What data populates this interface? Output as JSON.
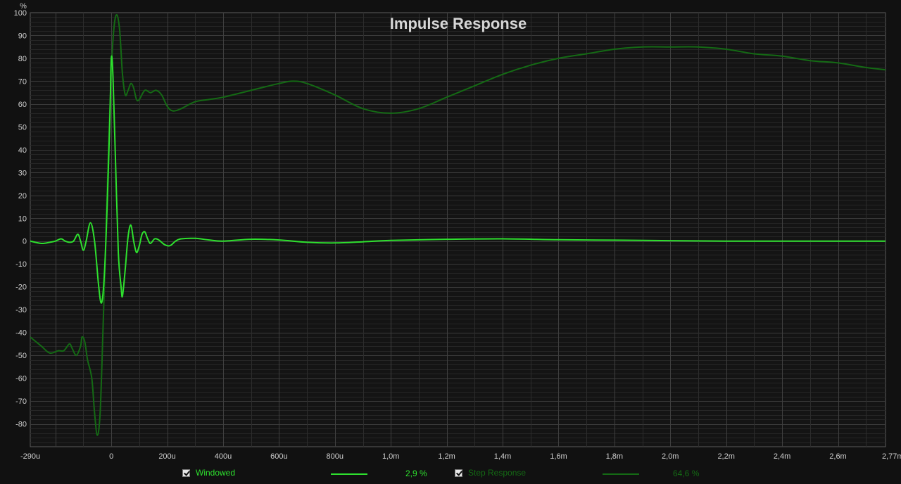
{
  "chart_data": {
    "type": "line",
    "title": "Impulse Response",
    "y_unit": "%",
    "x_unit": "ms",
    "xlim": [
      -0.29,
      2.77
    ],
    "ylim": [
      -90,
      100
    ],
    "x_ticks": [
      {
        "v": -0.29,
        "label": "-290u"
      },
      {
        "v": 0,
        "label": "0"
      },
      {
        "v": 0.2,
        "label": "200u"
      },
      {
        "v": 0.4,
        "label": "400u"
      },
      {
        "v": 0.6,
        "label": "600u"
      },
      {
        "v": 0.8,
        "label": "800u"
      },
      {
        "v": 1.0,
        "label": "1,0m"
      },
      {
        "v": 1.2,
        "label": "1,2m"
      },
      {
        "v": 1.4,
        "label": "1,4m"
      },
      {
        "v": 1.6,
        "label": "1,6m"
      },
      {
        "v": 1.8,
        "label": "1,8m"
      },
      {
        "v": 2.0,
        "label": "2,0m"
      },
      {
        "v": 2.2,
        "label": "2,2m"
      },
      {
        "v": 2.4,
        "label": "2,4m"
      },
      {
        "v": 2.6,
        "label": "2,6m"
      },
      {
        "v": 2.77,
        "label": "2,77ms"
      }
    ],
    "y_ticks": [
      {
        "v": 100,
        "label": "100"
      },
      {
        "v": 90,
        "label": "90"
      },
      {
        "v": 80,
        "label": "80"
      },
      {
        "v": 70,
        "label": "70"
      },
      {
        "v": 60,
        "label": "60"
      },
      {
        "v": 50,
        "label": "50"
      },
      {
        "v": 40,
        "label": "40"
      },
      {
        "v": 30,
        "label": "30"
      },
      {
        "v": 20,
        "label": "20"
      },
      {
        "v": 10,
        "label": "10"
      },
      {
        "v": 0,
        "label": "0"
      },
      {
        "v": -10,
        "label": "-10"
      },
      {
        "v": -20,
        "label": "-20"
      },
      {
        "v": -30,
        "label": "-30"
      },
      {
        "v": -40,
        "label": "-40"
      },
      {
        "v": -50,
        "label": "-50"
      },
      {
        "v": -60,
        "label": "-60"
      },
      {
        "v": -70,
        "label": "-70"
      },
      {
        "v": -80,
        "label": "-80"
      }
    ],
    "grid": true,
    "series": [
      {
        "name": "Windowed",
        "color": "#2ee02e",
        "points": [
          [
            -0.29,
            0
          ],
          [
            -0.25,
            -1
          ],
          [
            -0.22,
            -0.5
          ],
          [
            -0.2,
            0
          ],
          [
            -0.18,
            1
          ],
          [
            -0.165,
            0
          ],
          [
            -0.15,
            -0.5
          ],
          [
            -0.135,
            0
          ],
          [
            -0.12,
            3
          ],
          [
            -0.11,
            0
          ],
          [
            -0.1,
            -4
          ],
          [
            -0.09,
            0
          ],
          [
            -0.075,
            8
          ],
          [
            -0.06,
            0
          ],
          [
            -0.045,
            -20
          ],
          [
            -0.035,
            -27
          ],
          [
            -0.025,
            -15
          ],
          [
            -0.015,
            15
          ],
          [
            -0.005,
            55
          ],
          [
            0.0,
            80
          ],
          [
            0.006,
            72
          ],
          [
            0.015,
            35
          ],
          [
            0.025,
            -5
          ],
          [
            0.035,
            -20
          ],
          [
            0.04,
            -24
          ],
          [
            0.05,
            -12
          ],
          [
            0.06,
            2
          ],
          [
            0.07,
            7
          ],
          [
            0.08,
            0
          ],
          [
            0.09,
            -5
          ],
          [
            0.1,
            -2
          ],
          [
            0.11,
            3
          ],
          [
            0.12,
            4
          ],
          [
            0.13,
            1
          ],
          [
            0.14,
            -1
          ],
          [
            0.155,
            1
          ],
          [
            0.17,
            0.5
          ],
          [
            0.19,
            -1.5
          ],
          [
            0.21,
            -2
          ],
          [
            0.23,
            0
          ],
          [
            0.25,
            1
          ],
          [
            0.3,
            1.2
          ],
          [
            0.35,
            0.5
          ],
          [
            0.4,
            0
          ],
          [
            0.5,
            0.8
          ],
          [
            0.6,
            0.5
          ],
          [
            0.7,
            -0.5
          ],
          [
            0.8,
            -0.8
          ],
          [
            0.9,
            -0.3
          ],
          [
            1.0,
            0.3
          ],
          [
            1.2,
            0.8
          ],
          [
            1.4,
            1
          ],
          [
            1.6,
            0.6
          ],
          [
            1.8,
            0.4
          ],
          [
            2.0,
            0.2
          ],
          [
            2.2,
            0
          ],
          [
            2.4,
            0
          ],
          [
            2.6,
            0
          ],
          [
            2.77,
            0
          ]
        ]
      },
      {
        "name": "Step Response",
        "color": "#146a14",
        "points": [
          [
            -0.29,
            -42
          ],
          [
            -0.27,
            -44
          ],
          [
            -0.25,
            -46
          ],
          [
            -0.22,
            -49
          ],
          [
            -0.19,
            -48
          ],
          [
            -0.17,
            -48
          ],
          [
            -0.15,
            -45
          ],
          [
            -0.14,
            -47
          ],
          [
            -0.125,
            -50
          ],
          [
            -0.11,
            -46
          ],
          [
            -0.105,
            -42
          ],
          [
            -0.095,
            -44
          ],
          [
            -0.085,
            -52
          ],
          [
            -0.07,
            -60
          ],
          [
            -0.06,
            -75
          ],
          [
            -0.05,
            -85
          ],
          [
            -0.04,
            -75
          ],
          [
            -0.03,
            -40
          ],
          [
            -0.02,
            0
          ],
          [
            -0.01,
            40
          ],
          [
            0.0,
            75
          ],
          [
            0.01,
            94
          ],
          [
            0.02,
            99
          ],
          [
            0.03,
            92
          ],
          [
            0.04,
            73
          ],
          [
            0.05,
            64
          ],
          [
            0.06,
            66
          ],
          [
            0.07,
            69
          ],
          [
            0.08,
            67
          ],
          [
            0.09,
            62
          ],
          [
            0.1,
            62
          ],
          [
            0.12,
            66
          ],
          [
            0.14,
            65
          ],
          [
            0.16,
            66
          ],
          [
            0.18,
            64
          ],
          [
            0.2,
            59
          ],
          [
            0.22,
            57
          ],
          [
            0.25,
            58
          ],
          [
            0.3,
            61
          ],
          [
            0.35,
            62
          ],
          [
            0.4,
            63
          ],
          [
            0.5,
            66
          ],
          [
            0.6,
            69
          ],
          [
            0.65,
            70
          ],
          [
            0.7,
            69
          ],
          [
            0.8,
            64
          ],
          [
            0.9,
            58
          ],
          [
            1.0,
            56
          ],
          [
            1.1,
            58
          ],
          [
            1.2,
            63
          ],
          [
            1.3,
            68
          ],
          [
            1.4,
            73
          ],
          [
            1.5,
            77
          ],
          [
            1.6,
            80
          ],
          [
            1.7,
            82
          ],
          [
            1.8,
            84
          ],
          [
            1.9,
            85
          ],
          [
            2.0,
            85
          ],
          [
            2.1,
            85
          ],
          [
            2.2,
            84
          ],
          [
            2.3,
            82
          ],
          [
            2.4,
            81
          ],
          [
            2.5,
            79
          ],
          [
            2.6,
            78
          ],
          [
            2.7,
            76
          ],
          [
            2.77,
            75
          ]
        ]
      }
    ]
  },
  "legend": {
    "windowed_label": "Windowed",
    "windowed_value": "2,9 %",
    "windowed_color": "#2ee02e",
    "step_label": "Step Response",
    "step_value": "64,6 %",
    "step_color": "#146a14"
  }
}
